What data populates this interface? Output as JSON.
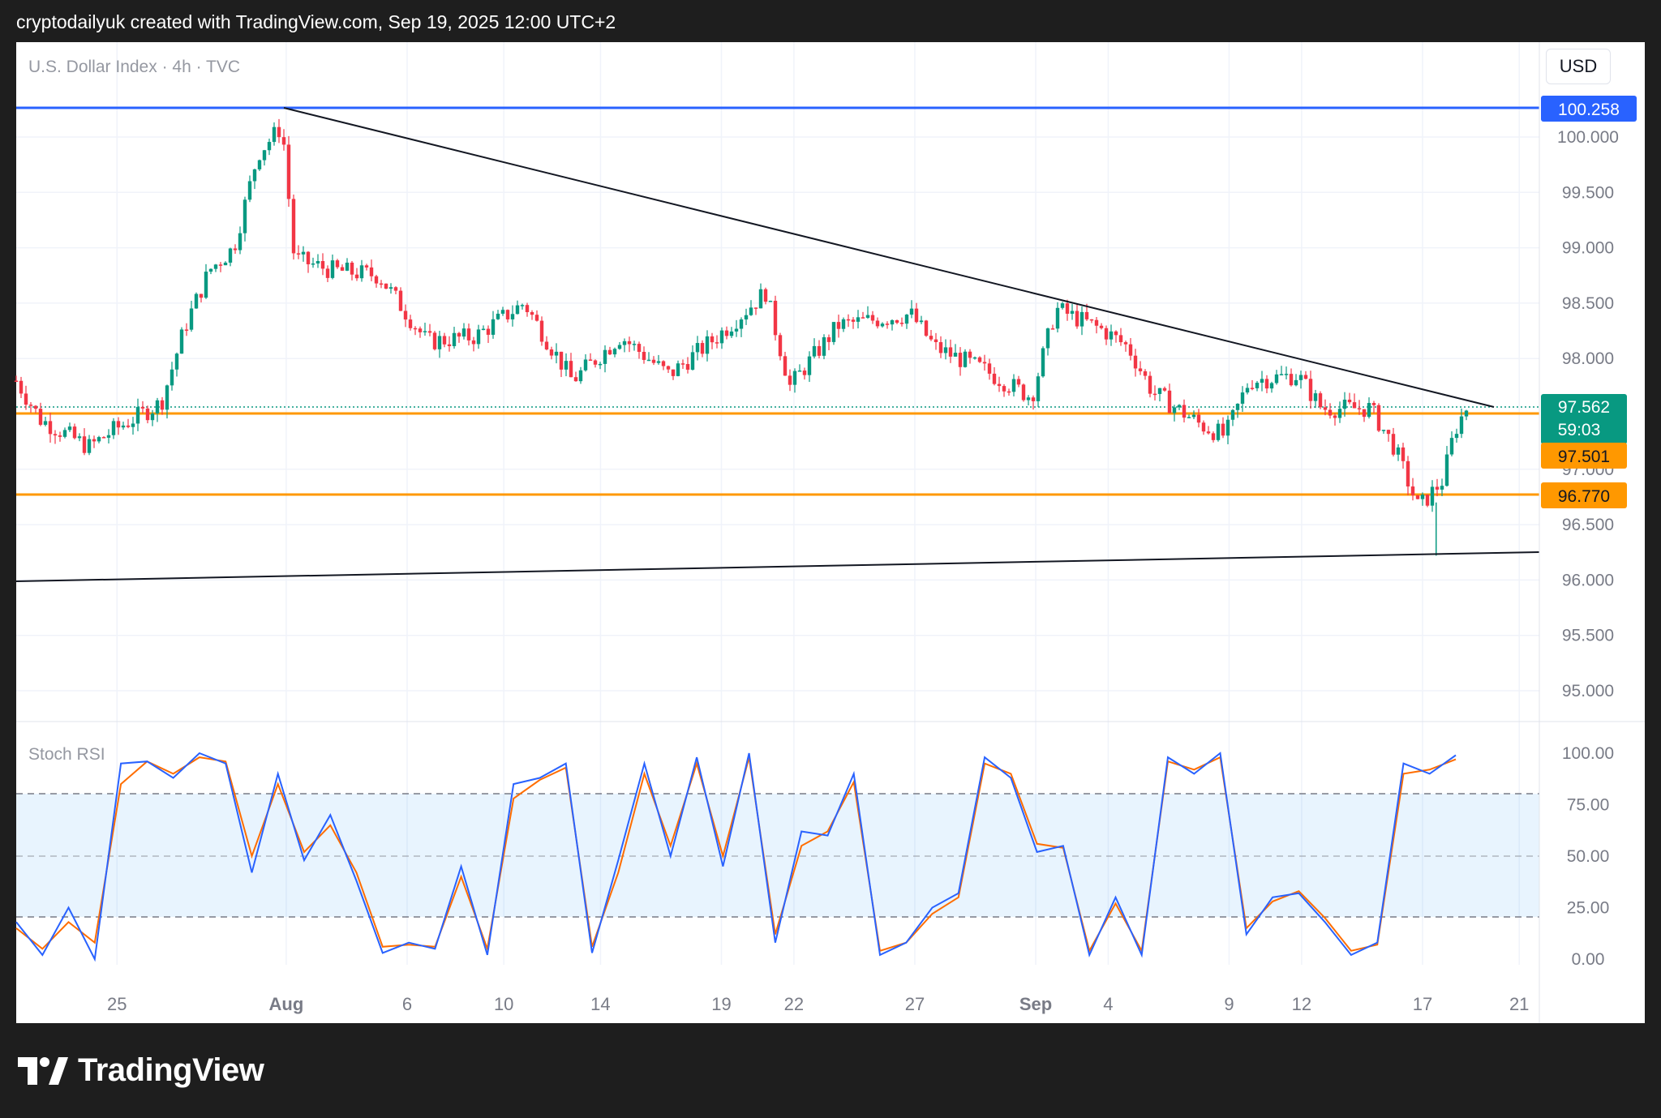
{
  "header": {
    "text": "cryptodailyuk created with TradingView.com, Sep 19, 2025 12:00 UTC+2"
  },
  "chart": {
    "legend": "U.S. Dollar Index · 4h · TVC",
    "currency": "USD",
    "price_axis_ticks": [
      "100.000",
      "99.500",
      "99.000",
      "98.500",
      "98.000",
      "97.500",
      "97.000",
      "96.500",
      "96.000",
      "95.500",
      "95.000"
    ],
    "date_axis_ticks": [
      "25",
      "Aug",
      "6",
      "10",
      "14",
      "19",
      "22",
      "27",
      "Sep",
      "4",
      "9",
      "12",
      "17",
      "21"
    ],
    "price_labels": {
      "resistance_top": "100.258",
      "last_price": "97.562",
      "countdown": "59:03",
      "level_1": "97.501",
      "level_2": "96.770"
    },
    "colors": {
      "up": "#089981",
      "down": "#f23645",
      "blue_line": "#2962ff",
      "orange_line": "#ff9800",
      "stoch_k": "#2962ff",
      "stoch_d": "#ff6d00"
    }
  },
  "stoch": {
    "label": "Stoch RSI",
    "ticks": [
      "100.00",
      "75.00",
      "50.00",
      "25.00",
      "0.00"
    ]
  },
  "footer": {
    "brand": "TradingView"
  },
  "chart_data": {
    "type": "candlestick",
    "title": "U.S. Dollar Index · 4h · TVC",
    "ylim": [
      94.7,
      100.6
    ],
    "x_range": [
      "Jul 21",
      "Sep 22"
    ],
    "horizontal_levels": [
      100.258,
      97.501,
      96.77
    ],
    "last_price": 97.562,
    "trendlines": [
      {
        "from": [
          "Aug 1",
          100.258
        ],
        "to": [
          "Sep 19",
          97.55
        ]
      },
      {
        "from": [
          "Jul 21",
          96.0
        ],
        "to": [
          "Sep 22",
          96.25
        ]
      }
    ],
    "price_path": [
      {
        "x": "Jul 21",
        "y": 97.8
      },
      {
        "x": "Jul 22",
        "y": 97.45
      },
      {
        "x": "Jul 24",
        "y": 97.2
      },
      {
        "x": "Jul 25",
        "y": 97.35
      },
      {
        "x": "Jul 27",
        "y": 97.6
      },
      {
        "x": "Jul 28",
        "y": 98.3
      },
      {
        "x": "Jul 29",
        "y": 98.8
      },
      {
        "x": "Jul 30",
        "y": 99.0
      },
      {
        "x": "Jul 31",
        "y": 99.85
      },
      {
        "x": "Aug 1",
        "y": 100.1
      },
      {
        "x": "Aug 1.5",
        "y": 98.9
      },
      {
        "x": "Aug 3",
        "y": 98.8
      },
      {
        "x": "Aug 5",
        "y": 98.75
      },
      {
        "x": "Aug 7",
        "y": 98.15
      },
      {
        "x": "Aug 9",
        "y": 98.2
      },
      {
        "x": "Aug 11",
        "y": 98.5
      },
      {
        "x": "Aug 13",
        "y": 97.8
      },
      {
        "x": "Aug 15",
        "y": 98.2
      },
      {
        "x": "Aug 17",
        "y": 97.85
      },
      {
        "x": "Aug 19",
        "y": 98.2
      },
      {
        "x": "Aug 21",
        "y": 98.6
      },
      {
        "x": "Aug 22",
        "y": 97.75
      },
      {
        "x": "Aug 24",
        "y": 98.3
      },
      {
        "x": "Aug 27",
        "y": 98.4
      },
      {
        "x": "Aug 28",
        "y": 98.1
      },
      {
        "x": "Aug 30",
        "y": 97.9
      },
      {
        "x": "Sep 1",
        "y": 97.65
      },
      {
        "x": "Sep 2",
        "y": 98.45
      },
      {
        "x": "Sep 4",
        "y": 98.25
      },
      {
        "x": "Sep 5",
        "y": 98.1
      },
      {
        "x": "Sep 6",
        "y": 97.7
      },
      {
        "x": "Sep 8",
        "y": 97.4
      },
      {
        "x": "Sep 9",
        "y": 97.3
      },
      {
        "x": "Sep 10",
        "y": 97.8
      },
      {
        "x": "Sep 12",
        "y": 97.85
      },
      {
        "x": "Sep 13",
        "y": 97.55
      },
      {
        "x": "Sep 15",
        "y": 97.55
      },
      {
        "x": "Sep 16",
        "y": 97.2
      },
      {
        "x": "Sep 17",
        "y": 96.65
      },
      {
        "x": "Sep 18",
        "y": 96.9
      },
      {
        "x": "Sep 18.5",
        "y": 97.35
      },
      {
        "x": "Sep 19",
        "y": 97.562
      }
    ],
    "stoch_rsi": {
      "ylim": [
        0,
        100
      ],
      "bands": [
        20,
        50,
        80
      ],
      "series": [
        {
          "name": "K",
          "values": [
            18,
            2,
            25,
            0,
            95,
            96,
            88,
            100,
            95,
            42,
            90,
            48,
            70,
            38,
            3,
            8,
            5,
            45,
            2,
            85,
            88,
            95,
            3,
            48,
            95,
            50,
            98,
            45,
            100,
            8,
            62,
            60,
            90,
            2,
            8,
            25,
            32,
            98,
            88,
            52,
            55,
            2,
            30,
            2,
            98,
            90,
            100,
            12,
            30,
            32,
            18,
            2,
            8,
            95,
            90,
            99
          ]
        },
        {
          "name": "D",
          "values": [
            15,
            5,
            18,
            8,
            85,
            96,
            90,
            98,
            96,
            50,
            85,
            52,
            65,
            42,
            6,
            7,
            6,
            40,
            5,
            78,
            87,
            93,
            6,
            42,
            90,
            55,
            95,
            50,
            98,
            12,
            55,
            62,
            86,
            4,
            8,
            22,
            30,
            95,
            90,
            56,
            54,
            4,
            27,
            4,
            96,
            92,
            98,
            15,
            28,
            33,
            20,
            4,
            7,
            90,
            92,
            97
          ]
        }
      ]
    }
  }
}
